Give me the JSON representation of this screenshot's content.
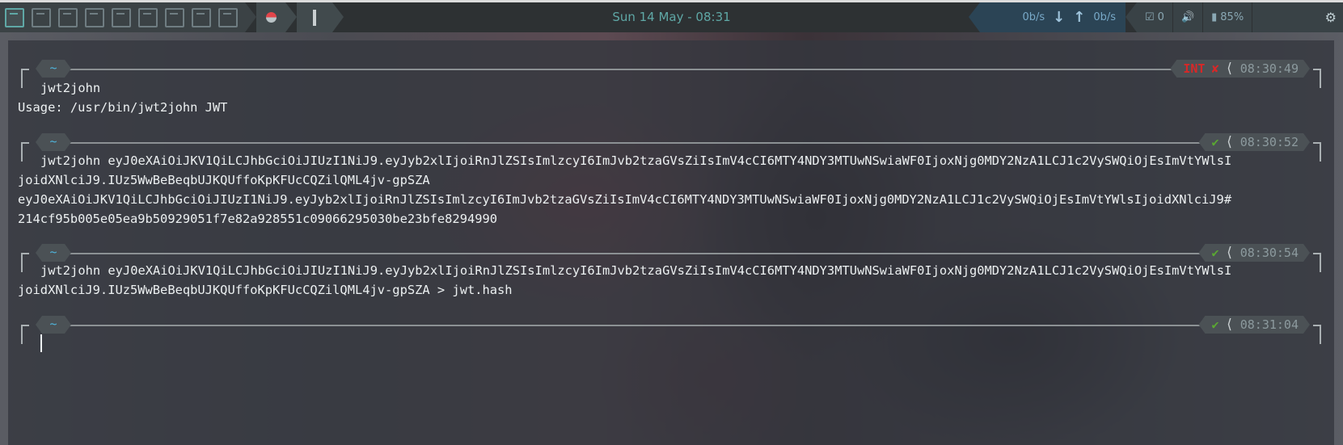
{
  "topbar": {
    "workspaces": [
      "ws-1",
      "ws-2",
      "ws-3",
      "ws-4",
      "ws-5",
      "ws-6",
      "ws-7",
      "ws-8",
      "ws-9"
    ],
    "datetime": "Sun 14 May - 08:31",
    "net_down": "0b/s",
    "net_up": "0b/s",
    "updates_count": "0",
    "battery": "85%"
  },
  "terminal": {
    "blocks": [
      {
        "prompt_dir": "~",
        "status": "INT",
        "status_icon": "✘",
        "time": "08:30:49",
        "command": "jwt2john",
        "output": [
          "Usage: /usr/bin/jwt2john JWT"
        ]
      },
      {
        "prompt_dir": "~",
        "status_icon": "✔",
        "time": "08:30:52",
        "command": "jwt2john eyJ0eXAiOiJKV1QiLCJhbGciOiJIUzI1NiJ9.eyJyb2xlIjoiRnJlZSIsImlzcyI6ImJvb2tzaGVsZiIsImV4cCI6MTY4NDY3MTUwNSwiaWF0IjoxNjg0MDY2NzA1LCJ1c2VySWQiOjEsImVtYWlsIjoidXNlciJ9.IUz5WwBeBeqbUJKQUffoKpKFUcCQZilQML4jv-gpSZA",
        "command_wrap": "joidXNlciJ9.IUz5WwBeBeqbUJKQUffoKpKFUcCQZilQML4jv-gpSZA",
        "command_line1": "jwt2john eyJ0eXAiOiJKV1QiLCJhbGciOiJIUzI1NiJ9.eyJyb2xlIjoiRnJlZSIsImlzcyI6ImJvb2tzaGVsZiIsImV4cCI6MTY4NDY3MTUwNSwiaWF0IjoxNjg0MDY2NzA1LCJ1c2VySWQiOjEsImVtYWlsI",
        "output": [
          "eyJ0eXAiOiJKV1QiLCJhbGciOiJIUzI1NiJ9.eyJyb2xlIjoiRnJlZSIsImlzcyI6ImJvb2tzaGVsZiIsImV4cCI6MTY4NDY3MTUwNSwiaWF0IjoxNjg0MDY2NzA1LCJ1c2VySWQiOjEsImVtYWlsIjoidXNlciJ9#",
          "214cf95b005e05ea9b50929051f7e82a928551c09066295030be23bfe8294990"
        ]
      },
      {
        "prompt_dir": "~",
        "status_icon": "✔",
        "time": "08:30:54",
        "command_line1": "jwt2john eyJ0eXAiOiJKV1QiLCJhbGciOiJIUzI1NiJ9.eyJyb2xlIjoiRnJlZSIsImlzcyI6ImJvb2tzaGVsZiIsImV4cCI6MTY4NDY3MTUwNSwiaWF0IjoxNjg0MDY2NzA1LCJ1c2VySWQiOjEsImVtYWlsI",
        "command_wrap": "joidXNlciJ9.IUz5WwBeBeqbUJKQUffoKpKFUcCQZilQML4jv-gpSZA > jwt.hash"
      },
      {
        "prompt_dir": "~",
        "status_icon": "✔",
        "time": "08:31:04"
      }
    ]
  }
}
